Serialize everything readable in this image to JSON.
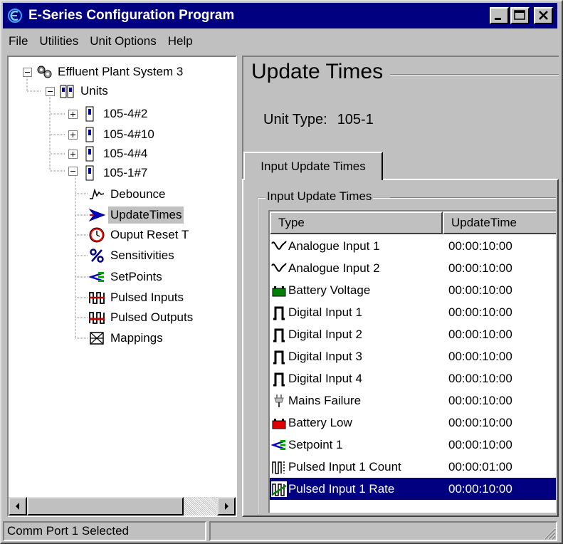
{
  "window": {
    "title": "E-Series Configuration Program",
    "accent_color": "#000080",
    "buttons": {
      "minimize": "minimize-icon",
      "maximize": "maximize-icon",
      "close": "close-icon"
    }
  },
  "menu": [
    "File",
    "Utilities",
    "Unit Options",
    "Help"
  ],
  "tree": {
    "root": "Effluent Plant System 3",
    "units_label": "Units",
    "units": [
      "105-4#2",
      "105-4#10",
      "105-4#4",
      "105-1#7"
    ],
    "children": [
      "Debounce",
      "UpdateTimes",
      "Ouput Reset T",
      "Sensitivities",
      "SetPoints",
      "Pulsed Inputs",
      "Pulsed Outputs",
      "Mappings"
    ],
    "selected": "UpdateTimes"
  },
  "page": {
    "title": "Update Times",
    "unit_type_label": "Unit Type:",
    "unit_type_value": "105-1",
    "tab_label": "Input Update Times",
    "group_label": "Input Update Times"
  },
  "table": {
    "columns": [
      "Type",
      "UpdateTime"
    ],
    "rows": [
      {
        "type": "Analogue Input 1",
        "time": "00:00:10:00",
        "icon": "analogue-wave-icon"
      },
      {
        "type": "Analogue Input 2",
        "time": "00:00:10:00",
        "icon": "analogue-wave-icon"
      },
      {
        "type": "Battery Voltage",
        "time": "00:00:10:00",
        "icon": "battery-green-icon"
      },
      {
        "type": "Digital Input 1",
        "time": "00:00:10:00",
        "icon": "digital-pulse-icon"
      },
      {
        "type": "Digital Input 2",
        "time": "00:00:10:00",
        "icon": "digital-pulse-icon"
      },
      {
        "type": "Digital Input 3",
        "time": "00:00:10:00",
        "icon": "digital-pulse-icon"
      },
      {
        "type": "Digital Input 4",
        "time": "00:00:10:00",
        "icon": "digital-pulse-icon"
      },
      {
        "type": "Mains Failure",
        "time": "00:00:10:00",
        "icon": "plug-icon"
      },
      {
        "type": "Battery Low",
        "time": "00:00:10:00",
        "icon": "battery-red-icon"
      },
      {
        "type": "Setpoint 1",
        "time": "00:00:10:00",
        "icon": "setpoint-icon"
      },
      {
        "type": "Pulsed Input 1 Count",
        "time": "00:00:01:00",
        "icon": "pulse-count-icon"
      },
      {
        "type": "Pulsed Input 1 Rate",
        "time": "00:00:10:00",
        "icon": "pulse-rate-icon"
      }
    ],
    "selected_row": "Pulsed Input 1 Rate"
  },
  "status": {
    "text": "Comm Port 1 Selected",
    "text2": ""
  }
}
